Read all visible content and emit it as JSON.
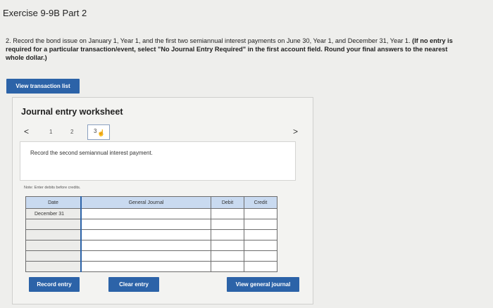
{
  "header": {
    "title": "Exercise 9-9B Part 2"
  },
  "instructions": {
    "prefix": "2. Record the bond issue on January 1, Year 1, and the first two semiannual interest payments on June 30, Year 1, and December 31, Year 1. ",
    "bold": "(If no entry is required for a particular transaction/event, select \"No Journal Entry Required\" in the first account field. Round your final answers to the nearest whole dollar.)"
  },
  "buttons": {
    "view_transaction_list": "View transaction list",
    "record_entry": "Record entry",
    "clear_entry": "Clear entry",
    "view_general_journal": "View general journal"
  },
  "worksheet": {
    "title": "Journal entry worksheet",
    "nav": {
      "prev": "<",
      "next": ">",
      "pages": [
        "1",
        "2",
        "3"
      ],
      "current": "3"
    },
    "description": "Record the second semiannual interest payment.",
    "note": "Note: Enter debits before credits."
  },
  "table": {
    "headers": [
      "Date",
      "General Journal",
      "Debit",
      "Credit"
    ],
    "rows": [
      {
        "date": "December 31",
        "account": "",
        "debit": "",
        "credit": ""
      },
      {
        "date": "",
        "account": "",
        "debit": "",
        "credit": ""
      },
      {
        "date": "",
        "account": "",
        "debit": "",
        "credit": ""
      },
      {
        "date": "",
        "account": "",
        "debit": "",
        "credit": ""
      },
      {
        "date": "",
        "account": "",
        "debit": "",
        "credit": ""
      },
      {
        "date": "",
        "account": "",
        "debit": "",
        "credit": ""
      }
    ]
  },
  "colors": {
    "accent": "#2c63a8",
    "header_fill": "#c9daf0",
    "background": "#eeeeec"
  },
  "icons": {
    "pointer": "hand-pointer-icon"
  }
}
